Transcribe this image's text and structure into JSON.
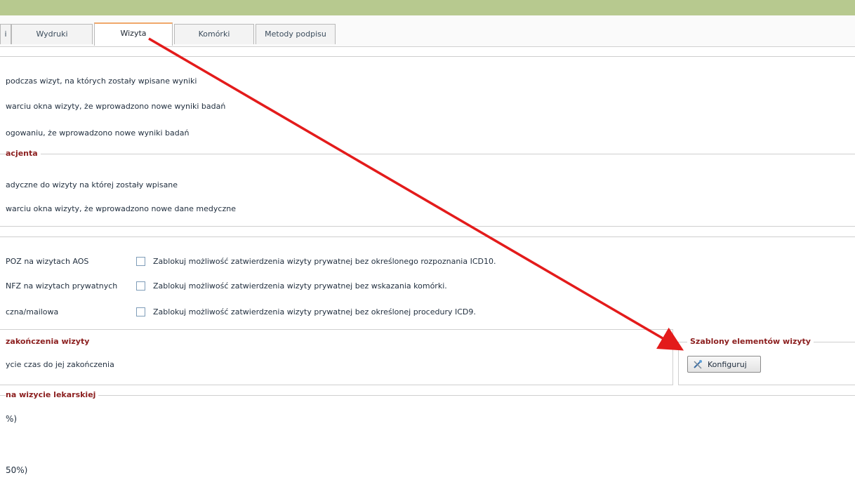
{
  "tabs": [
    {
      "label": "i"
    },
    {
      "label": "Wydruki"
    },
    {
      "label": "Wizyta"
    },
    {
      "label": "Komórki"
    },
    {
      "label": "Metody podpisu"
    }
  ],
  "results_section": {
    "lines": [
      "podczas wizyt, na których zostały wpisane wyniki",
      "warciu okna wizyty, że wprowadzono nowe wyniki badań",
      "ogowaniu, że wprowadzono nowe wyniki badań"
    ]
  },
  "patient_section": {
    "title": "acjenta",
    "lines": [
      "adyczne do wizyty na której zostały wpisane",
      "warciu okna wizyty, że wprowadzono nowe dane medyczne"
    ]
  },
  "options": {
    "left": [
      "POZ na wizytach AOS",
      "NFZ na wizytach prywatnych",
      "czna/mailowa"
    ],
    "right": [
      "Zablokuj możliwość zatwierdzenia wizyty prywatnej bez określonego rozpoznania ICD10.",
      "Zablokuj możliwość zatwierdzenia wizyty prywatnej bez wskazania komórki.",
      "Zablokuj możliwość zatwierdzenia wizyty prywatnej bez określonej procedury ICD9."
    ]
  },
  "end_section": {
    "title": "zakończenia wizyty",
    "line": "ycie czas do jej zakończenia"
  },
  "templates_section": {
    "title": "Szablony elementów wizyty",
    "button_label": "Konfiguruj",
    "button_icon": "tools-icon"
  },
  "doctor_section": {
    "title": "na wizycie lekarskiej",
    "lines": [
      "%)",
      "50%)"
    ]
  },
  "colors": {
    "header_bar": "#b7c98f",
    "section_title": "#8b1e1e",
    "active_tab_accent": "#f0a86b",
    "annotation_arrow": "#e31b1b"
  }
}
